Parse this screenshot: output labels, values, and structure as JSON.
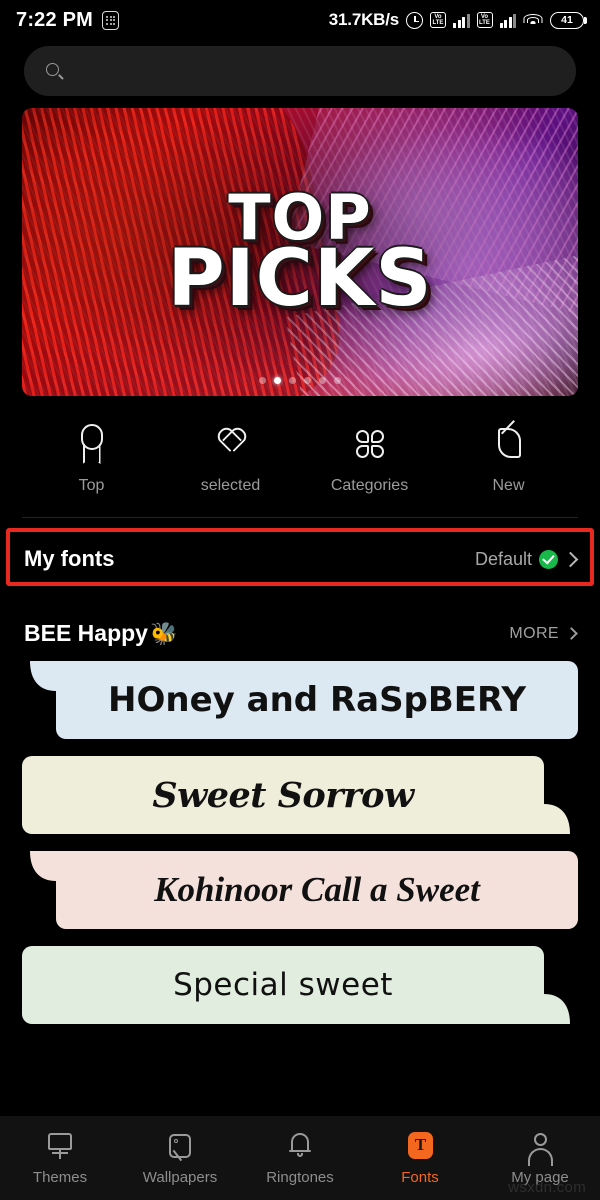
{
  "status_bar": {
    "time": "7:22 PM",
    "keypad_icon": "dots-grid-icon",
    "net_speed": "31.7KB/s",
    "alarm_icon": "alarm-icon",
    "volte_label_1": "VoLTE",
    "volte_label_2": "VoLTE",
    "wifi_icon": "wifi-icon",
    "battery_level": "41"
  },
  "search": {
    "icon": "search-icon",
    "value": "",
    "placeholder": ""
  },
  "banner": {
    "title_line1": "TOP",
    "title_line2": "PICKS",
    "dot_count": 6,
    "active_dot_index": 1
  },
  "quick_nav": {
    "items": [
      {
        "label": "Top",
        "icon": "medal-icon"
      },
      {
        "label": "selected",
        "icon": "heart-icon"
      },
      {
        "label": "Categories",
        "icon": "grid-flower-icon"
      },
      {
        "label": "New",
        "icon": "leaf-icon"
      }
    ]
  },
  "my_fonts": {
    "title": "My fonts",
    "value": "Default",
    "badge_icon": "check-circle-icon",
    "chevron_icon": "chevron-right-icon",
    "highlight_color": "#e8291f"
  },
  "section": {
    "title": "BEE Happy",
    "title_emoji": "🐝",
    "more_label": "MORE",
    "more_chevron_icon": "chevron-right-icon"
  },
  "font_cards": [
    {
      "text": "HOney and RaSpBERY",
      "bg": "#dce8f2",
      "tail": "left"
    },
    {
      "text": "Sweet Sorrow",
      "bg": "#efeedb",
      "tail": "right"
    },
    {
      "text": "Kohinoor  Call a Sweet",
      "bg": "#f5e1dc",
      "tail": "left"
    },
    {
      "text": "Special sweet",
      "bg": "#e1edde",
      "tail": "right"
    }
  ],
  "tab_bar": {
    "items": [
      {
        "label": "Themes",
        "icon": "paint-roller-icon",
        "active": false
      },
      {
        "label": "Wallpapers",
        "icon": "image-icon",
        "active": false
      },
      {
        "label": "Ringtones",
        "icon": "bell-icon",
        "active": false
      },
      {
        "label": "Fonts",
        "icon": "letter-t-icon",
        "active": true
      },
      {
        "label": "My page",
        "icon": "person-icon",
        "active": false
      }
    ],
    "active_color": "#f4671f"
  },
  "watermark": "wsxdn.com"
}
